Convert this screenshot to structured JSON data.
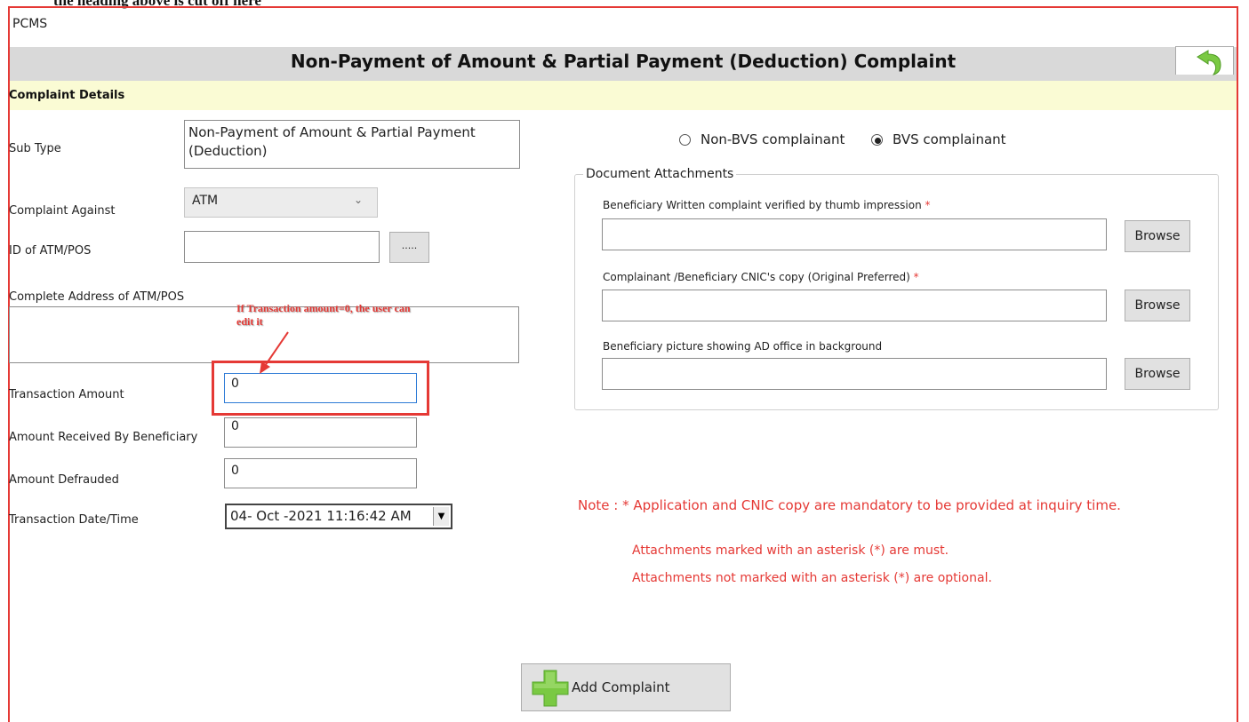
{
  "window": {
    "app_title": "PCMS"
  },
  "header": {
    "title": "Non-Payment of Amount & Partial Payment (Deduction) Complaint",
    "back_icon": "undo-arrow-icon"
  },
  "section": {
    "title": "Complaint Details"
  },
  "form": {
    "sub_type": {
      "label": "Sub Type",
      "value": "Non-Payment of Amount & Partial Payment (Deduction)"
    },
    "complaint_against": {
      "label": "Complaint Against",
      "value": "ATM"
    },
    "atm_id": {
      "label": "ID of ATM/POS",
      "value": "",
      "picker_label": "....."
    },
    "address": {
      "label": "Complete Address of ATM/POS",
      "value": ""
    },
    "transaction_amount": {
      "label": "Transaction Amount",
      "value": "0"
    },
    "amount_received": {
      "label": "Amount Received By Beneficiary",
      "value": "0"
    },
    "amount_defrauded": {
      "label": "Amount Defrauded",
      "value": "0"
    },
    "transaction_datetime": {
      "label": "Transaction Date/Time",
      "value": "04- Oct -2021 11:16:42 AM"
    }
  },
  "complainant_type": {
    "options": [
      "Non-BVS complainant",
      "BVS complainant"
    ],
    "selected": "BVS complainant"
  },
  "attachments": {
    "legend": "Document Attachments",
    "items": [
      {
        "label": "Beneficiary Written complaint verified by thumb impression",
        "required_mark": "*",
        "value": "",
        "button": "Browse"
      },
      {
        "label": "Complainant /Beneficiary CNIC's copy (Original Preferred)",
        "required_mark": "*",
        "value": "",
        "button": "Browse"
      },
      {
        "label": "Beneficiary picture showing AD office in background",
        "required_mark": "",
        "value": "",
        "button": "Browse"
      }
    ]
  },
  "notes": {
    "main": "Note : * Application and CNIC copy are mandatory to be provided at inquiry time.",
    "line1": "Attachments marked with an asterisk (*) are must.",
    "line2": "Attachments not marked with an asterisk (*) are optional."
  },
  "annotation": {
    "text": "If Transaction amount=0, the user can edit it"
  },
  "actions": {
    "add_complaint": "Add Complaint",
    "add_icon": "green-plus-icon"
  },
  "colors": {
    "accent_red": "#e53935",
    "header_gray": "#d9d9d9",
    "section_yellow": "#fafbd4",
    "plus_green": "#7ac943"
  }
}
